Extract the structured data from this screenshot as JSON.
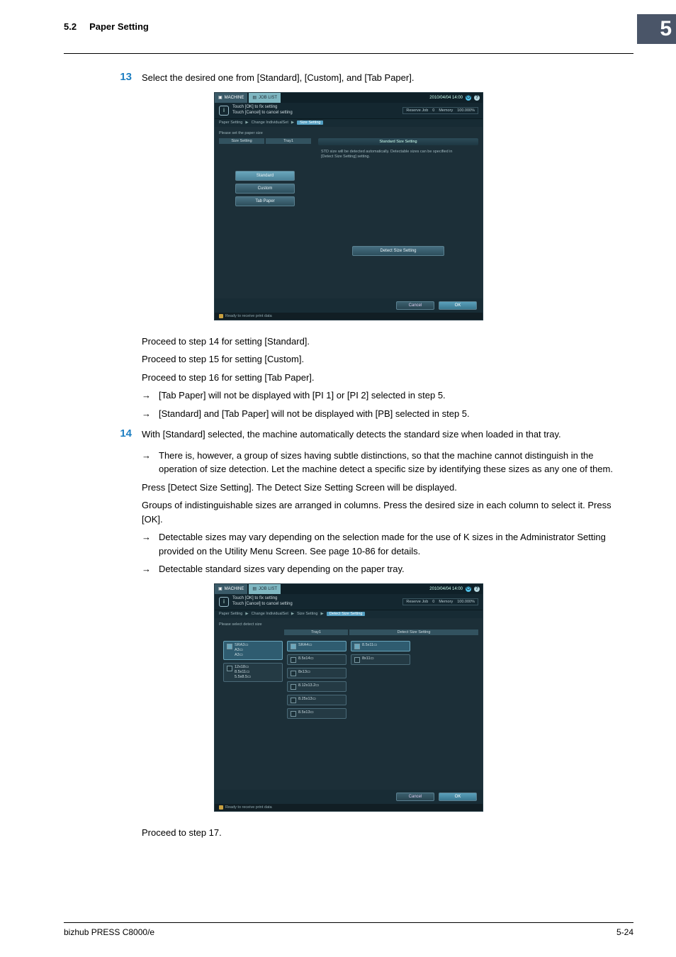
{
  "header": {
    "section_num": "5.2",
    "section_title": "Paper Setting",
    "chapter_num": "5"
  },
  "step13": {
    "num": "13",
    "text": "Select the desired one from [Standard], [Custom], and [Tab Paper]."
  },
  "after13": {
    "l1": "Proceed to step 14 for setting [Standard].",
    "l2": "Proceed to step 15 for setting [Custom].",
    "l3": "Proceed to step 16 for setting [Tab Paper].",
    "b1": "[Tab Paper] will not be displayed with [PI 1] or [PI 2] selected in step 5.",
    "b2": "[Standard] and [Tab Paper] will not be displayed with [PB] selected in step 5."
  },
  "step14": {
    "num": "14",
    "text": "With [Standard] selected, the machine automatically detects the standard size when loaded in that tray.",
    "b1": "There is, however, a group of sizes having subtle distinctions, so that the machine cannot distinguish in the operation of size detection. Let the machine detect a specific size by identifying these sizes as any one of them.",
    "p1": "Press [Detect Size Setting]. The Detect Size Setting Screen will be displayed.",
    "p2": "Groups of indistinguishable sizes are arranged in columns. Press the desired size in each column to select it. Press [OK].",
    "b2": "Detectable sizes may vary depending on the selection made for the use of K sizes in the Administrator Setting provided on the Utility Menu Screen. See page 10-86 for details.",
    "b3": "Detectable standard sizes vary depending on the paper tray."
  },
  "afterScreens": {
    "l1": "Proceed to step 17."
  },
  "footer": {
    "left": "bizhub PRESS C8000/e",
    "right": "5-24"
  },
  "arrow_glyph": "→",
  "screen_common": {
    "tab_machine": "MACHINE",
    "tab_joblist": "JOB LIST",
    "datetime": "2010/04/04  14:00",
    "msg1": "Touch [OK] to fix setting",
    "msg2": "Touch [Cancel] to cancel setting",
    "reserve": "Reserve Job",
    "reserve_n": "0",
    "memory": "Memory",
    "memory_pct": "100.000%",
    "bc1": "Paper Setting",
    "bc2": "Change IndividualSet",
    "bc3": "Size Setting",
    "cancel": "Cancel",
    "ok": "OK",
    "status": "Ready to receive print data"
  },
  "screen1": {
    "instr": "Please set the paper size",
    "hdr1": "Size Setting",
    "hdr2": "Tray1",
    "right_title": "Standard Size Setting",
    "right_desc": "STD size will be detected automatically. Detectable sizes can be specified in [Detect Size Setting] setting.",
    "btn_standard": "Standard",
    "btn_custom": "Custom",
    "btn_tab": "Tab Paper",
    "btn_detect": "Detect Size Setting"
  },
  "screen2": {
    "bc4": "Detect Size Setting",
    "instr": "Please select detect size",
    "hdr2": "Tray1",
    "hdr3": "Detect Size Setting",
    "col1": {
      "o1": "SRA3▭\nA3▭\nA3▭",
      "o2": "12x18▭\n8.5x11▭\n5.5x8.5▭"
    },
    "col2": {
      "o1": "SRA4▭",
      "o2": "8.5x14▭",
      "o3": "8x13▭",
      "o4": "8.12x13.2▭",
      "o5": "8.25x13▭",
      "o6": "8.5x13▭"
    },
    "col3": {
      "o1": "8.5x11▭",
      "o2": "8x11▭"
    }
  }
}
